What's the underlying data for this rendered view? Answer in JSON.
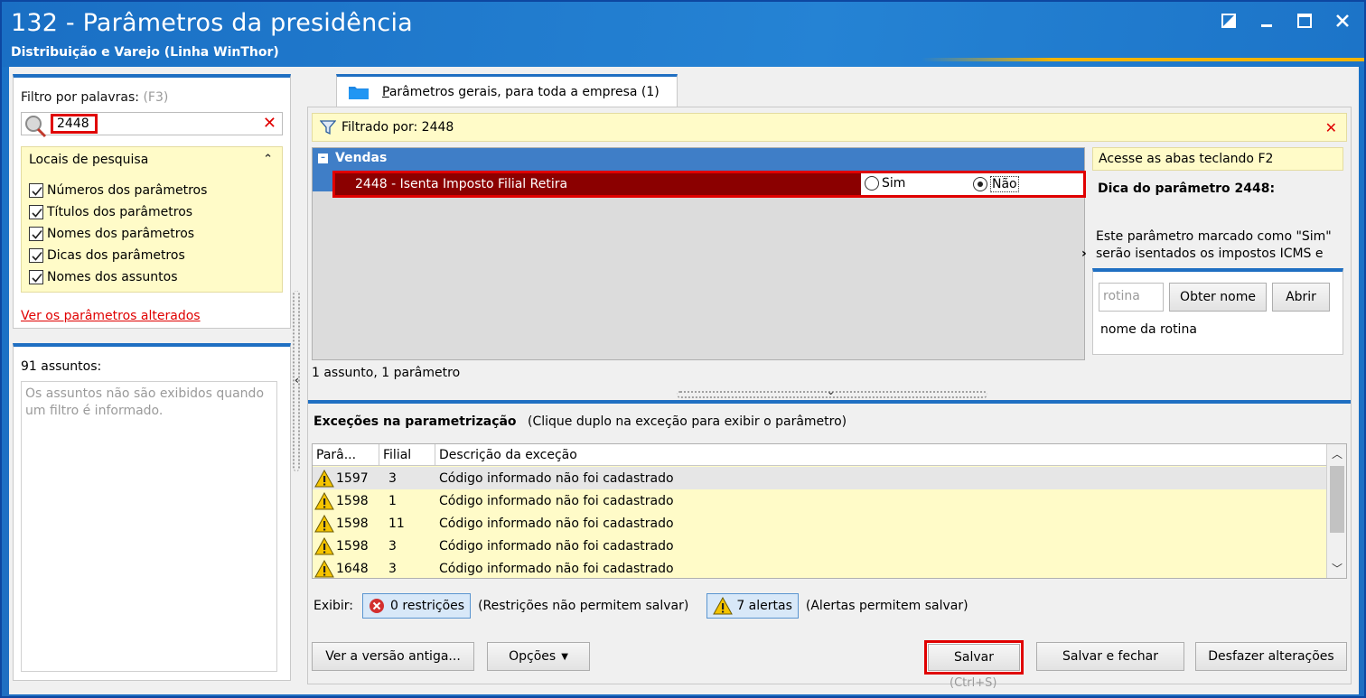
{
  "window": {
    "title": "132 - Parâmetros da presidência",
    "subtitle": "Distribuição e Varejo (Linha WinThor)"
  },
  "left": {
    "filter_label": "Filtro por palavras:",
    "filter_hint": "(F3)",
    "search_value": "2448",
    "locais_title": "Locais de pesquisa",
    "checkboxes": [
      {
        "label": "Números dos parâmetros",
        "checked": true
      },
      {
        "label": "Títulos dos parâmetros",
        "checked": true
      },
      {
        "label": "Nomes dos parâmetros",
        "checked": true
      },
      {
        "label": "Dicas dos parâmetros",
        "checked": true
      },
      {
        "label": "Nomes dos assuntos",
        "checked": true
      }
    ],
    "altered_link": "Ver os parâmetros alterados",
    "assuntos_count": "91 assuntos:",
    "assuntos_msg": "Os assuntos não são exibidos quando um filtro é informado."
  },
  "tab": {
    "label": "Parâmetros gerais, para toda a empresa  (1)"
  },
  "filter_bar": {
    "text": "Filtrado por: 2448"
  },
  "grid": {
    "group": "Vendas",
    "param_name": "2448 - Isenta Imposto Filial Retira",
    "option_sim": "Sim",
    "option_nao": "Não",
    "selected": "Não",
    "footer": "1 assunto, 1 parâmetro"
  },
  "help": {
    "top": "Acesse as abas teclando F2",
    "title": "Dica do parâmetro 2448:",
    "line1": "Este parâmetro marcado como \"Sim\"",
    "line2": "serão isentados os impostos ICMS e",
    "rotina_placeholder": "rotina",
    "obter_nome": "Obter nome",
    "abrir": "Abrir",
    "rotina_caption": "nome da rotina"
  },
  "exceptions": {
    "title": "Exceções na parametrização",
    "subtitle": "(Clique duplo na exceção para exibir o parâmetro)",
    "columns": [
      "Parâ...",
      "Filial",
      "Descrição da exceção"
    ],
    "rows": [
      {
        "param": "1597",
        "filial": "3",
        "desc": "Código informado não foi cadastrado"
      },
      {
        "param": "1598",
        "filial": "1",
        "desc": "Código informado não foi cadastrado"
      },
      {
        "param": "1598",
        "filial": "11",
        "desc": "Código informado não foi cadastrado"
      },
      {
        "param": "1598",
        "filial": "3",
        "desc": "Código informado não foi cadastrado"
      },
      {
        "param": "1648",
        "filial": "3",
        "desc": "Código informado não foi cadastrado"
      }
    ],
    "exibir_label": "Exibir:",
    "restricoes_btn": "0 restrições",
    "restricoes_note": "(Restrições não permitem salvar)",
    "alertas_btn": "7 alertas",
    "alertas_note": "(Alertas permitem salvar)"
  },
  "buttons": {
    "versao_antiga": "Ver a versão antiga...",
    "opcoes": "Opções",
    "salvar": "Salvar",
    "salvar_shortcut": "(Ctrl+S)",
    "salvar_fechar": "Salvar e fechar",
    "desfazer": "Desfazer alterações"
  },
  "colors": {
    "title_bar": "#1f6fc2",
    "highlight_red": "#e00000",
    "selected_row": "#8b0000",
    "yellow_panel": "#fffbc8"
  }
}
